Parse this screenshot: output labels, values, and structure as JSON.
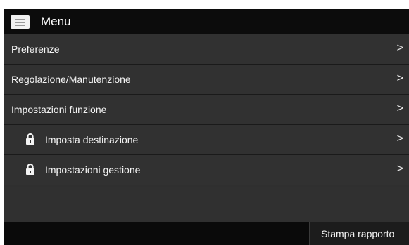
{
  "header": {
    "title": "Menu",
    "icon": "menu-icon"
  },
  "menu": {
    "items": [
      {
        "label": "Preferenze",
        "locked": false,
        "chevron": ">"
      },
      {
        "label": "Regolazione/Manutenzione",
        "locked": false,
        "chevron": ">"
      },
      {
        "label": "Impostazioni funzione",
        "locked": false,
        "chevron": ">"
      },
      {
        "label": "Imposta destinazione",
        "locked": true,
        "chevron": ">"
      },
      {
        "label": "Impostazioni gestione",
        "locked": true,
        "chevron": ">"
      }
    ]
  },
  "footer": {
    "report_button_label": "Stampa rapporto"
  },
  "colors": {
    "title_bar": "#0c0c0c",
    "list_background": "#313131",
    "text": "#f4f4f4"
  }
}
